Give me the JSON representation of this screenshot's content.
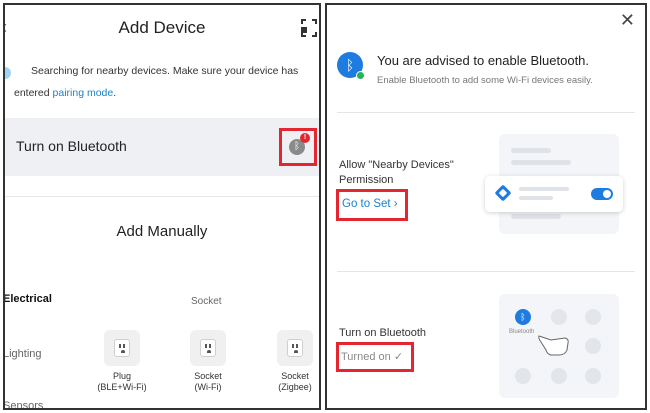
{
  "left_panel": {
    "title": "Add Device",
    "back_icon": "chevron-left-icon",
    "scan_icon": "scan-icon",
    "search_text_1": "Searching for nearby devices. Make sure your device has",
    "search_text_2_prefix": "entered ",
    "search_link": "pairing mode",
    "search_text_2_suffix": ".",
    "bluetooth_row_label": "Turn on Bluetooth",
    "bluetooth_badge": "!",
    "add_manually_title": "Add Manually",
    "categories": [
      "Electrical",
      "Lighting",
      "Sensors"
    ],
    "section_label": "Socket",
    "devices": [
      {
        "name_line1": "Plug",
        "name_line2": "(BLE+Wi-Fi)"
      },
      {
        "name_line1": "Socket",
        "name_line2": "(Wi-Fi)"
      },
      {
        "name_line1": "Socket",
        "name_line2": "(Zigbee)"
      }
    ]
  },
  "right_panel": {
    "close_icon": "close-icon",
    "title": "You are advised to enable Bluetooth.",
    "subtitle": "Enable Bluetooth to add some Wi-Fi devices easily.",
    "permission_line1": "Allow \"Nearby Devices\"",
    "permission_line2": "Permission",
    "go_to_set": "Go to Set",
    "go_to_set_chevron": "›",
    "turn_on_bluetooth": "Turn on Bluetooth",
    "turned_on": "Turned on",
    "turned_on_check": "✓",
    "illustration_bluetooth_label": "Bluetooth"
  },
  "colors": {
    "accent_blue": "#1c82c9",
    "highlight_red": "#e3262f",
    "bluetooth_blue": "#1e7be0"
  }
}
